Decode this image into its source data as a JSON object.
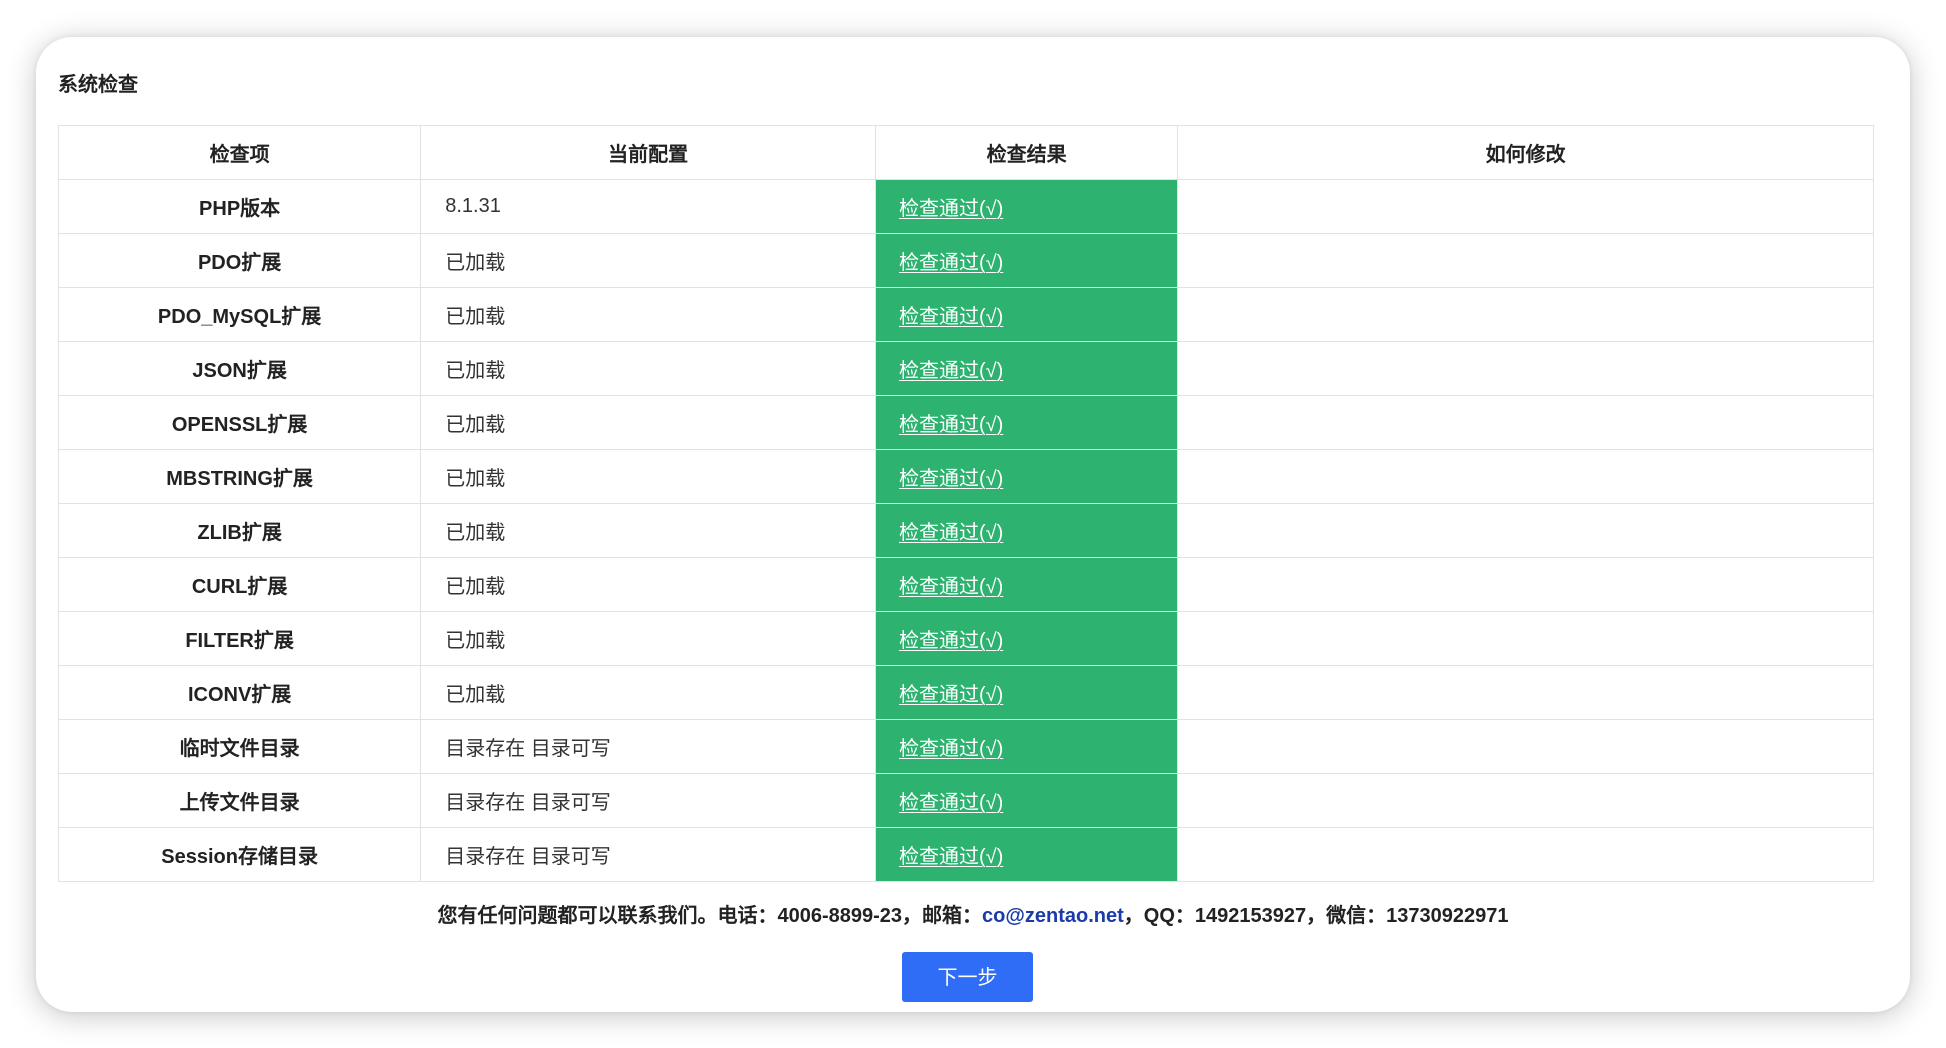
{
  "panel": {
    "title": "系统检查"
  },
  "table": {
    "headers": {
      "item": "检查项",
      "config": "当前配置",
      "result": "检查结果",
      "fix": "如何修改"
    },
    "rows": [
      {
        "item": "PHP版本",
        "config": "8.1.31",
        "result": "检查通过(√)",
        "fix": ""
      },
      {
        "item": "PDO扩展",
        "config": "已加载",
        "result": "检查通过(√)",
        "fix": ""
      },
      {
        "item": "PDO_MySQL扩展",
        "config": "已加载",
        "result": "检查通过(√)",
        "fix": ""
      },
      {
        "item": "JSON扩展",
        "config": "已加载",
        "result": "检查通过(√)",
        "fix": ""
      },
      {
        "item": "OPENSSL扩展",
        "config": "已加载",
        "result": "检查通过(√)",
        "fix": ""
      },
      {
        "item": "MBSTRING扩展",
        "config": "已加载",
        "result": "检查通过(√)",
        "fix": ""
      },
      {
        "item": "ZLIB扩展",
        "config": "已加载",
        "result": "检查通过(√)",
        "fix": ""
      },
      {
        "item": "CURL扩展",
        "config": "已加载",
        "result": "检查通过(√)",
        "fix": ""
      },
      {
        "item": "FILTER扩展",
        "config": "已加载",
        "result": "检查通过(√)",
        "fix": ""
      },
      {
        "item": "ICONV扩展",
        "config": "已加载",
        "result": "检查通过(√)",
        "fix": ""
      },
      {
        "item": "临时文件目录",
        "config": "目录存在 目录可写",
        "result": "检查通过(√)",
        "fix": ""
      },
      {
        "item": "上传文件目录",
        "config": "目录存在 目录可写",
        "result": "检查通过(√)",
        "fix": ""
      },
      {
        "item": "Session存储目录",
        "config": "目录存在 目录可写",
        "result": "检查通过(√)",
        "fix": ""
      }
    ]
  },
  "contact": {
    "prefix": "您有任何问题都可以联系我们。电话：4006-8899-23，邮箱：",
    "email": "co@zentao.net",
    "suffix": "，QQ：1492153927，微信：13730922971"
  },
  "actions": {
    "next_label": "下一步"
  },
  "colors": {
    "pass_green": "#2eb270",
    "primary_blue": "#2f6df6",
    "link_blue": "#1a3ba8"
  }
}
